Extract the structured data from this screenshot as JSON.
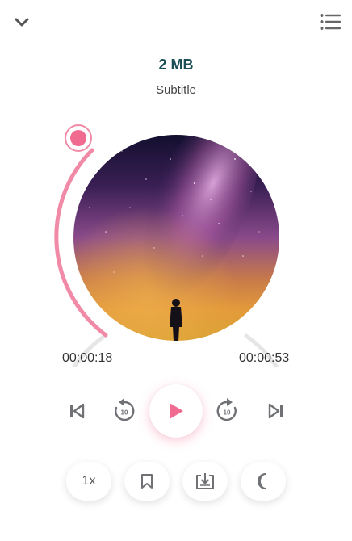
{
  "header": {
    "collapse_icon": "chevron-down-icon",
    "playlist_icon": "list-icon"
  },
  "track": {
    "title": "2 MB",
    "subtitle": "Subtitle"
  },
  "progress": {
    "elapsed": "00:00:18",
    "total": "00:00:53",
    "fraction": 0.34
  },
  "controls": {
    "previous_icon": "skip-previous-icon",
    "rewind_icon": "replay-10-icon",
    "rewind_label": "10",
    "play_icon": "play-icon",
    "forward_icon": "forward-10-icon",
    "forward_label": "10",
    "next_icon": "skip-next-icon"
  },
  "bottom_bar": {
    "speed_label": "1x",
    "bookmark_icon": "bookmark-icon",
    "download_icon": "download-icon",
    "sleep_icon": "moon-icon"
  },
  "colors": {
    "accent": "#f06b90",
    "accent_light": "#f08aa6",
    "track": "#e6e6e6",
    "title": "#1c4e57",
    "icon": "#6f7175"
  }
}
